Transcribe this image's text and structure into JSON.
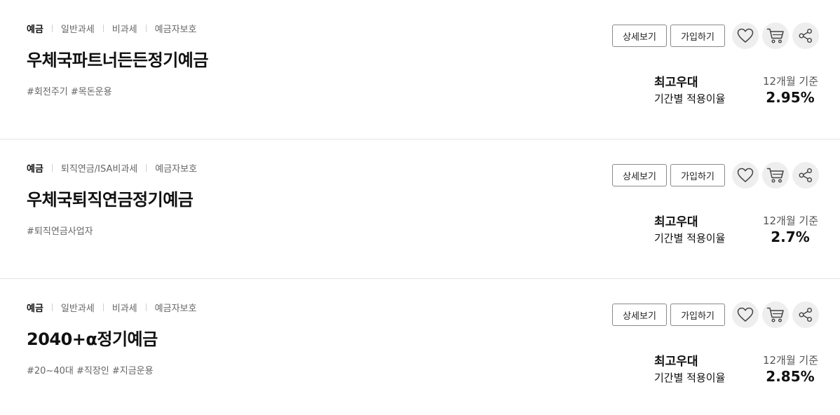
{
  "buttons": {
    "detail_label": "상세보기",
    "join_label": "가입하기"
  },
  "icons": {
    "favorite": "heart-icon",
    "cart": "cart-icon",
    "share": "share-icon"
  },
  "rate_labels": {
    "max_label": "최고우대",
    "period_label": "기간별 적용이율"
  },
  "products": [
    {
      "tags": [
        "예금",
        "일반과세",
        "비과세",
        "예금자보호"
      ],
      "name": "우체국파트너든든정기예금",
      "hashtags": "#회전주기 #목돈운용",
      "basis": "12개월 기준",
      "rate": "2.95%"
    },
    {
      "tags": [
        "예금",
        "퇴직연금/ISA비과세",
        "예금자보호"
      ],
      "name": "우체국퇴직연금정기예금",
      "hashtags": "#퇴직연금사업자",
      "basis": "12개월 기준",
      "rate": "2.7%"
    },
    {
      "tags": [
        "예금",
        "일반과세",
        "비과세",
        "예금자보호"
      ],
      "name": "2040+α정기예금",
      "hashtags": "#20~40대 #직장인 #지금운용",
      "basis": "12개월 기준",
      "rate": "2.85%"
    }
  ]
}
